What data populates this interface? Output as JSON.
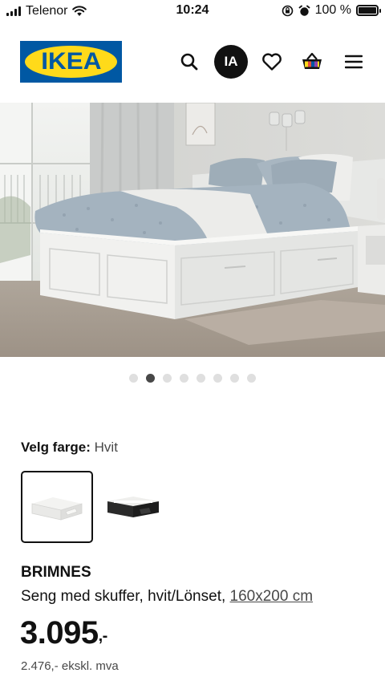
{
  "status_bar": {
    "carrier": "Telenor",
    "time": "10:24",
    "battery": "100 %"
  },
  "header": {
    "logo_text": "IKEA",
    "avatar_initials": "IA"
  },
  "gallery": {
    "image_count": 8,
    "active_index": 1
  },
  "color": {
    "label": "Velg farge:",
    "value": "Hvit",
    "options": [
      "white",
      "black"
    ]
  },
  "product": {
    "name": "BRIMNES",
    "description": "Seng med skuffer, hvit/Lönset,",
    "size": "160x200 cm",
    "price": "3.095",
    "price_suffix": ",-",
    "excl_vat": "2.476,- ekskl. mva"
  },
  "colors": {
    "ikea_blue": "#0058a3",
    "ikea_yellow": "#ffda1a"
  }
}
